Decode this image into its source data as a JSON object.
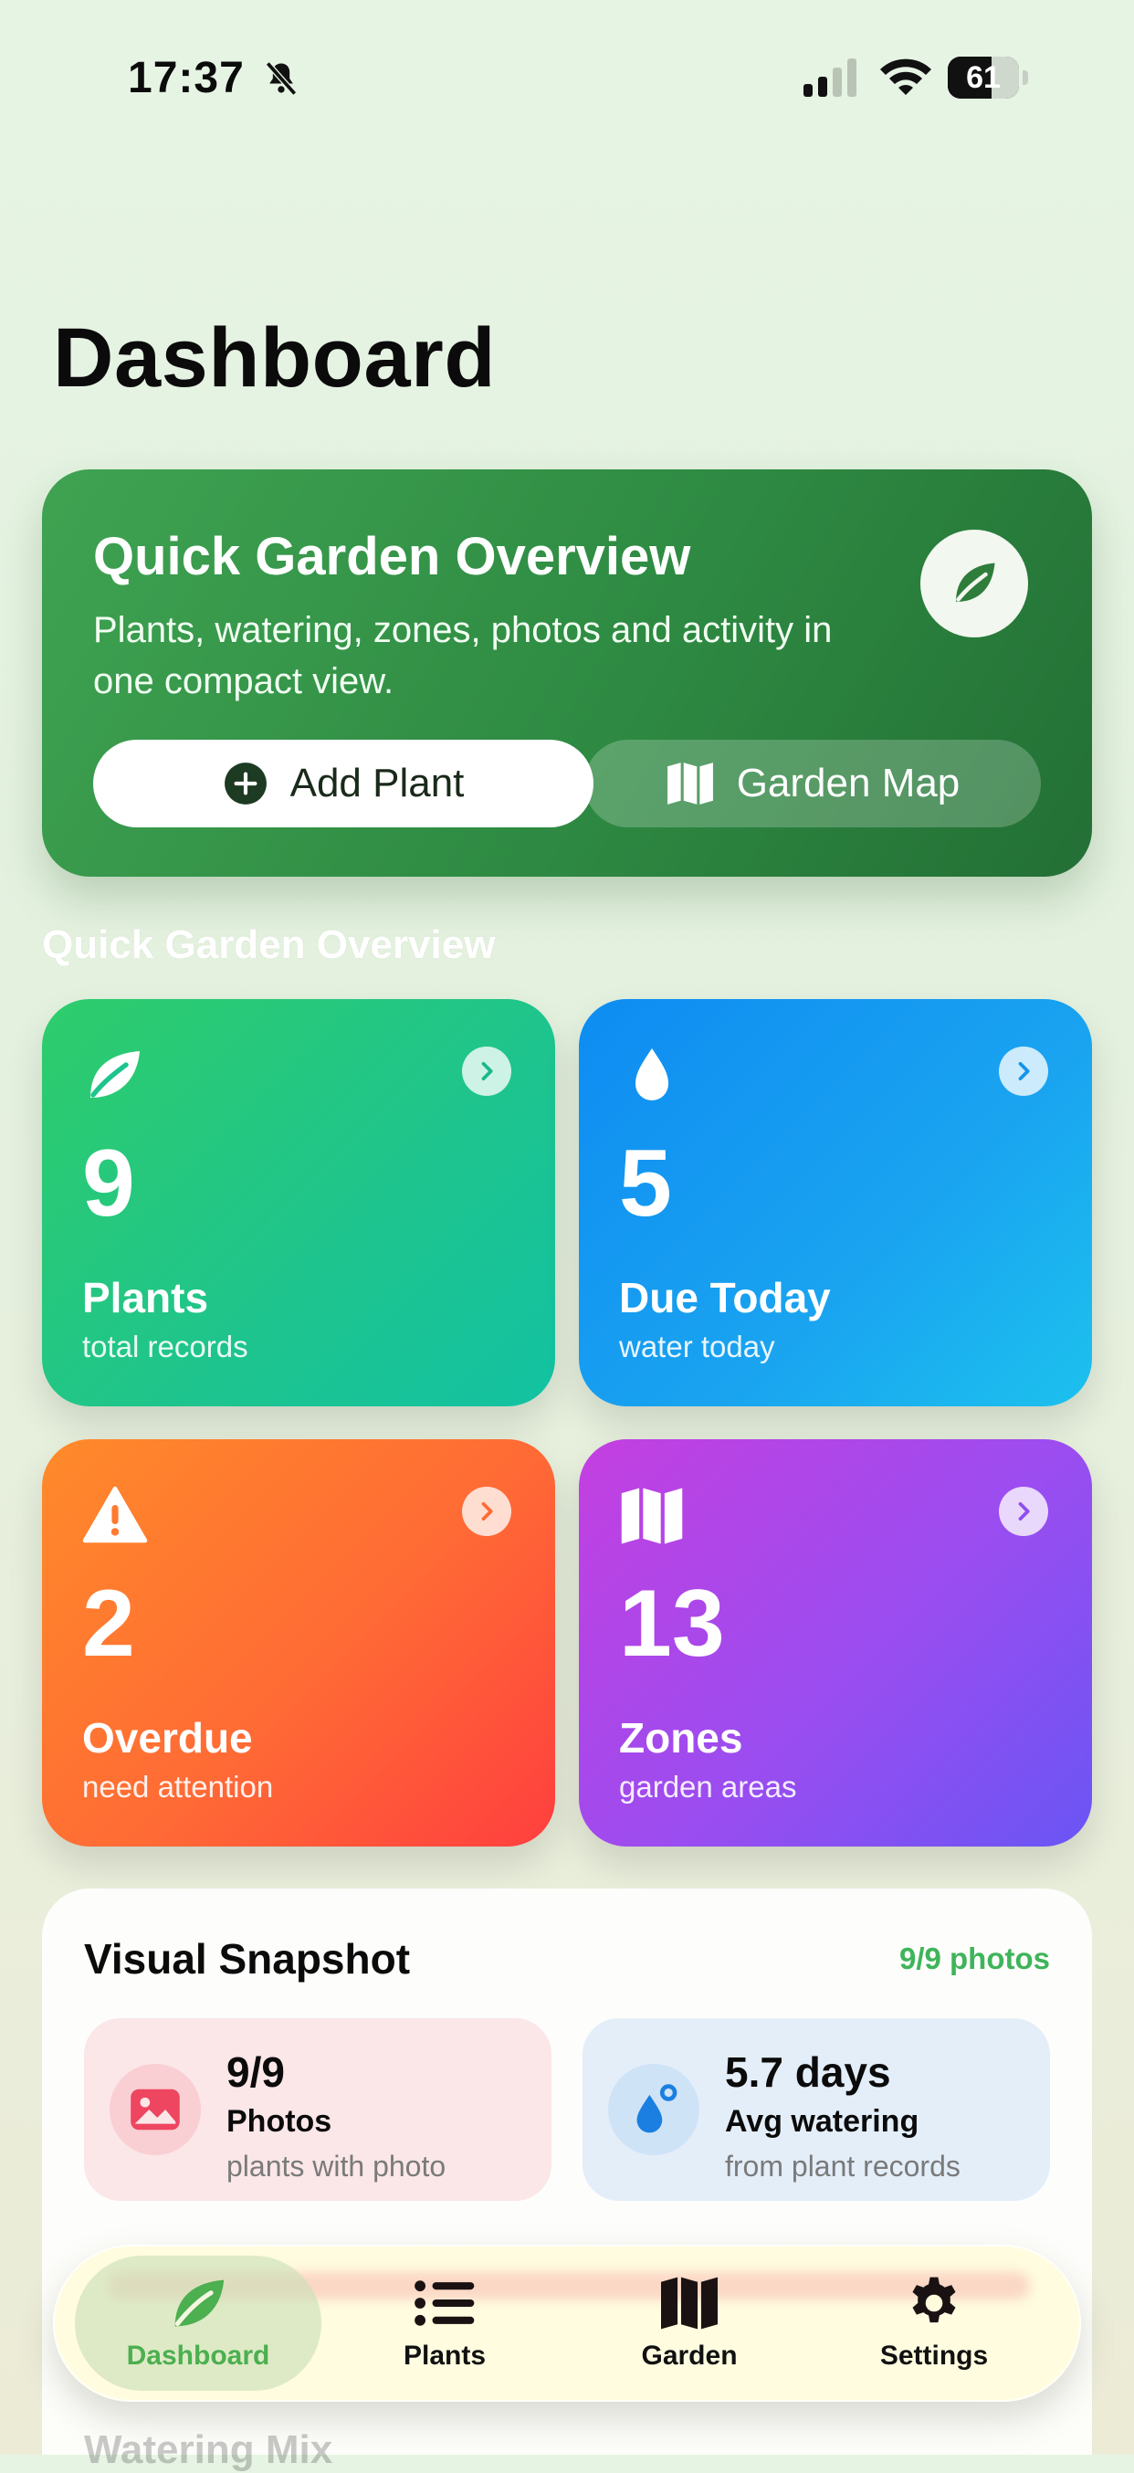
{
  "status_bar": {
    "time": "17:37",
    "battery": "61",
    "battery_level": 0.61
  },
  "page": {
    "title": "Dashboard"
  },
  "hero": {
    "title": "Quick Garden Overview",
    "subtitle": "Plants, watering, zones, photos and activity in one compact view.",
    "add_label": "Add Plant",
    "map_label": "Garden Map",
    "icon": "leaf-icon"
  },
  "section_label": "Quick Garden Overview",
  "stats": {
    "plants": {
      "value": "9",
      "label": "Plants",
      "sub": "total records"
    },
    "due": {
      "value": "5",
      "label": "Due Today",
      "sub": "water today"
    },
    "overdue": {
      "value": "2",
      "label": "Overdue",
      "sub": "need attention"
    },
    "zones": {
      "value": "13",
      "label": "Zones",
      "sub": "garden areas"
    }
  },
  "snapshot": {
    "title": "Visual Snapshot",
    "meta": "9/9 photos",
    "photos": {
      "value": "9/9",
      "label": "Photos",
      "sub": "plants with photo"
    },
    "watering": {
      "value": "5.7 days",
      "label": "Avg watering",
      "sub": "from plant records"
    },
    "next_section": "Watering Mix"
  },
  "tabs": [
    {
      "label": "Dashboard",
      "icon": "leaf-icon",
      "active": true
    },
    {
      "label": "Plants",
      "icon": "list-icon",
      "active": false
    },
    {
      "label": "Garden",
      "icon": "map-icon",
      "active": false
    },
    {
      "label": "Settings",
      "icon": "gear-icon",
      "active": false
    }
  ],
  "colors": {
    "accent_green": "#3fb45a",
    "hero_green": "#2e8a42",
    "plants_card": "#1ec48e",
    "due_card": "#1aa4f0",
    "overdue_card": "#ff6a35",
    "zones_card": "#9a4df0"
  }
}
